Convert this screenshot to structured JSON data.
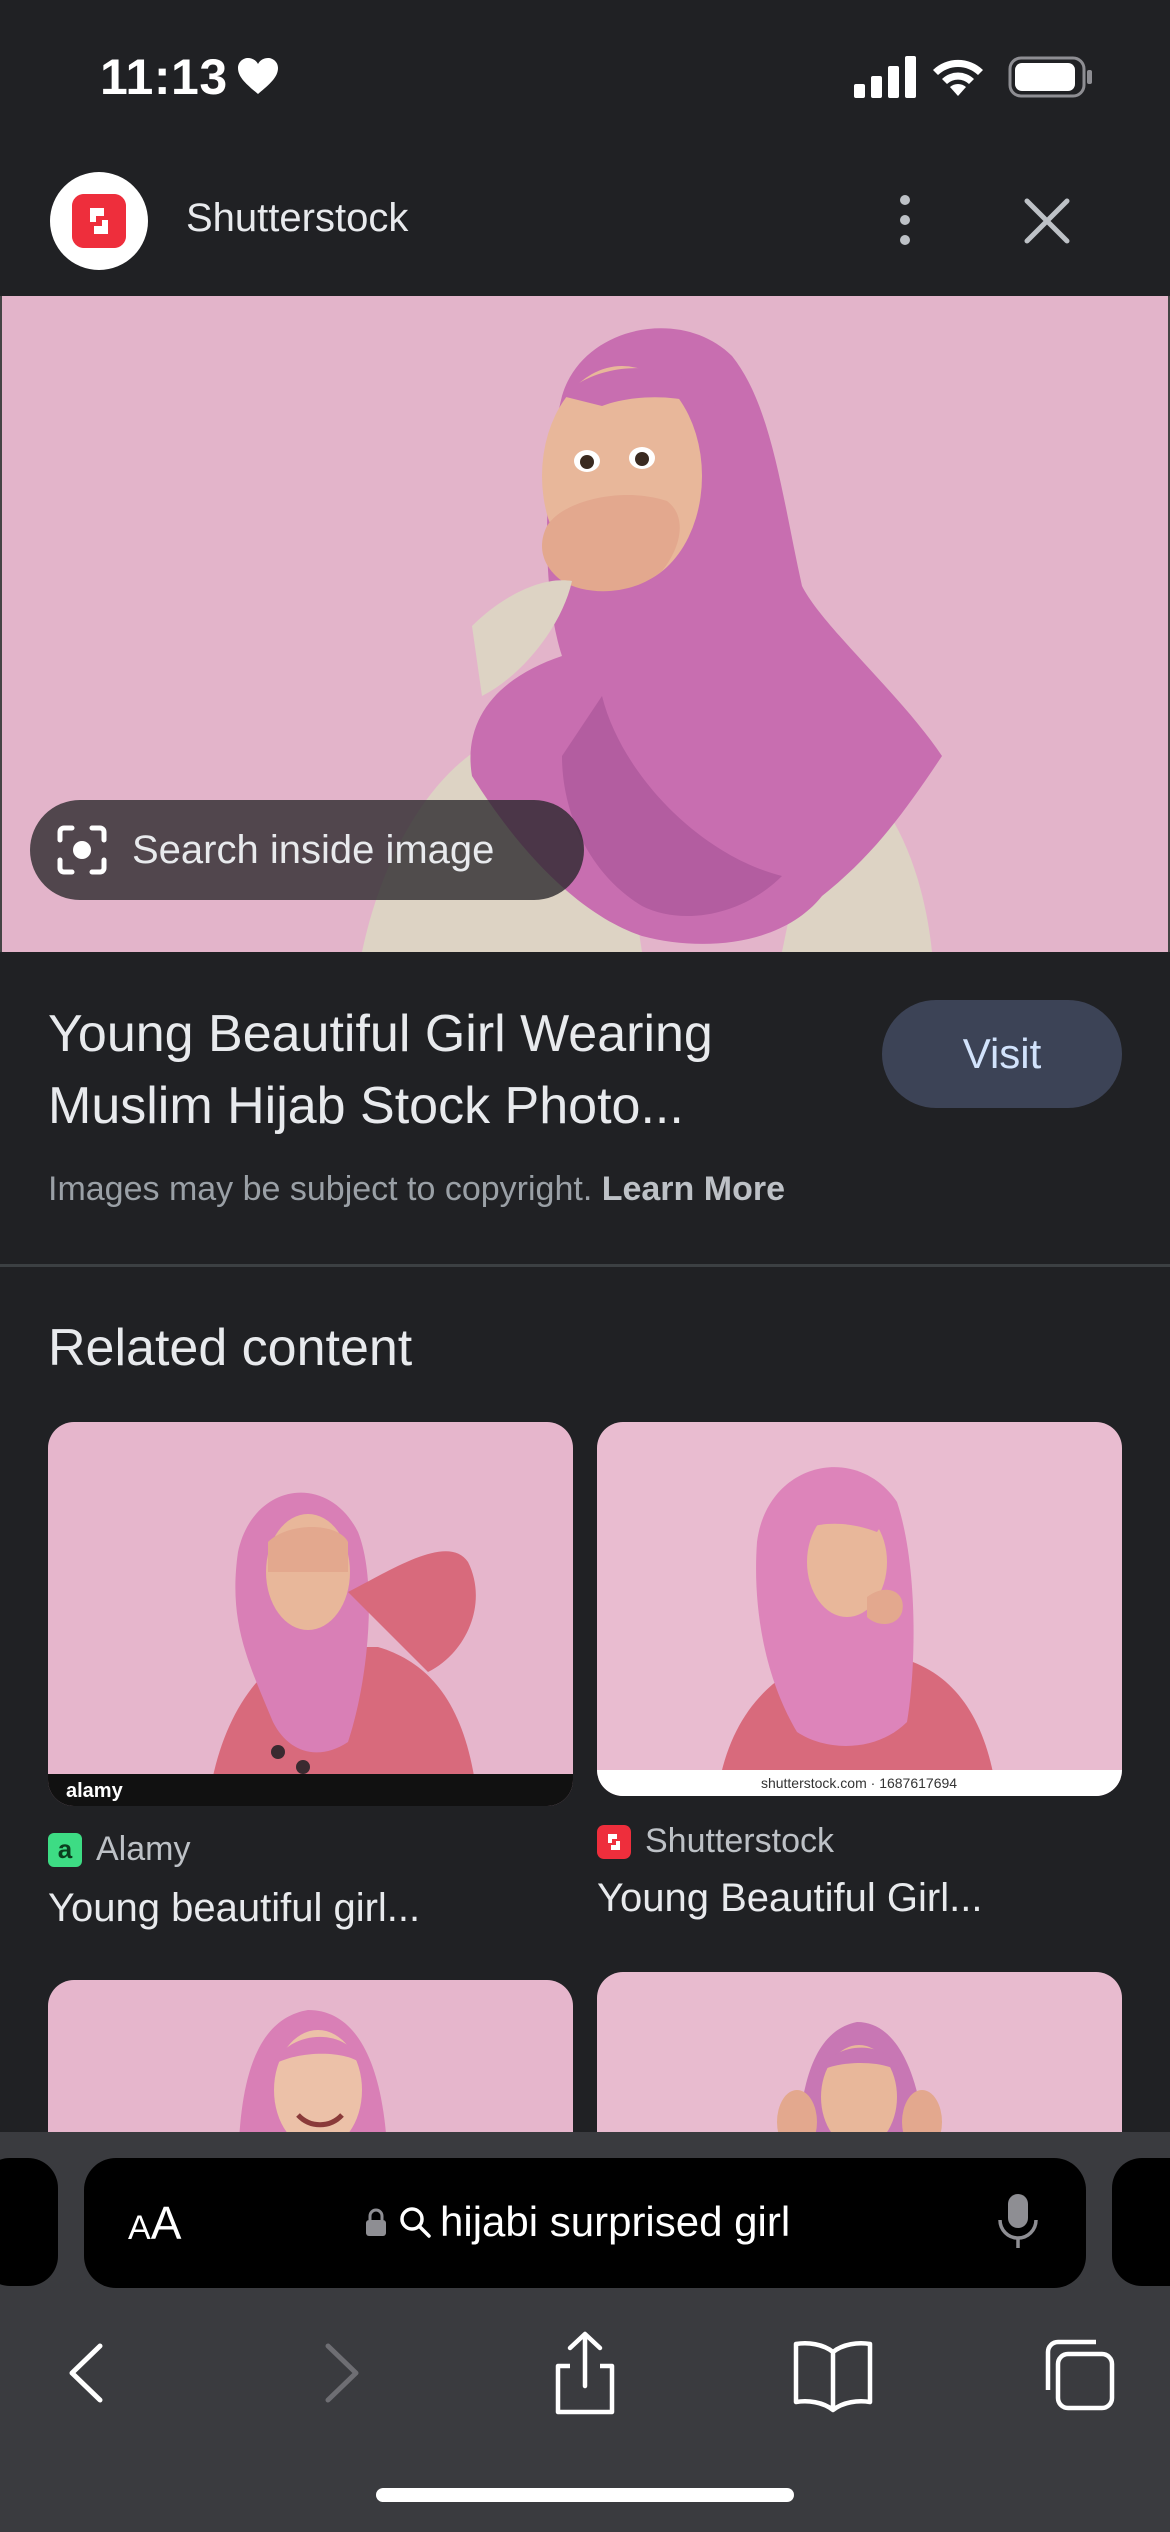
{
  "status_bar": {
    "time": "11:13"
  },
  "header": {
    "source_name": "Shutterstock"
  },
  "main": {
    "search_inside_label": "Search inside image",
    "title": "Young Beautiful Girl Wearing Muslim Hijab Stock Photo...",
    "visit_label": "Visit",
    "copyright_text": "Images may be subject to copyright.",
    "learn_more_label": "Learn More"
  },
  "related": {
    "heading": "Related content",
    "items": [
      {
        "source": "Alamy",
        "title": "Young beautiful girl...",
        "favicon_letter": "a",
        "favicon_color": "#3ddc84"
      },
      {
        "source": "Shutterstock",
        "title": "Young Beautiful Girl...",
        "favicon_color": "#ee2e3c",
        "caption": "shutterstock.com · 1687617694"
      },
      {
        "source": "",
        "title": ""
      },
      {
        "source": "",
        "title": ""
      }
    ],
    "alamy_watermark": "alamy"
  },
  "browser": {
    "aa_label_small": "A",
    "aa_label_large": "A",
    "url_text": "hijabi surprised girl"
  },
  "colors": {
    "background": "#202124",
    "accent_visit": "#3c4356",
    "pink_bg": "#e7b9cf",
    "hijab": "#c96fb0"
  }
}
